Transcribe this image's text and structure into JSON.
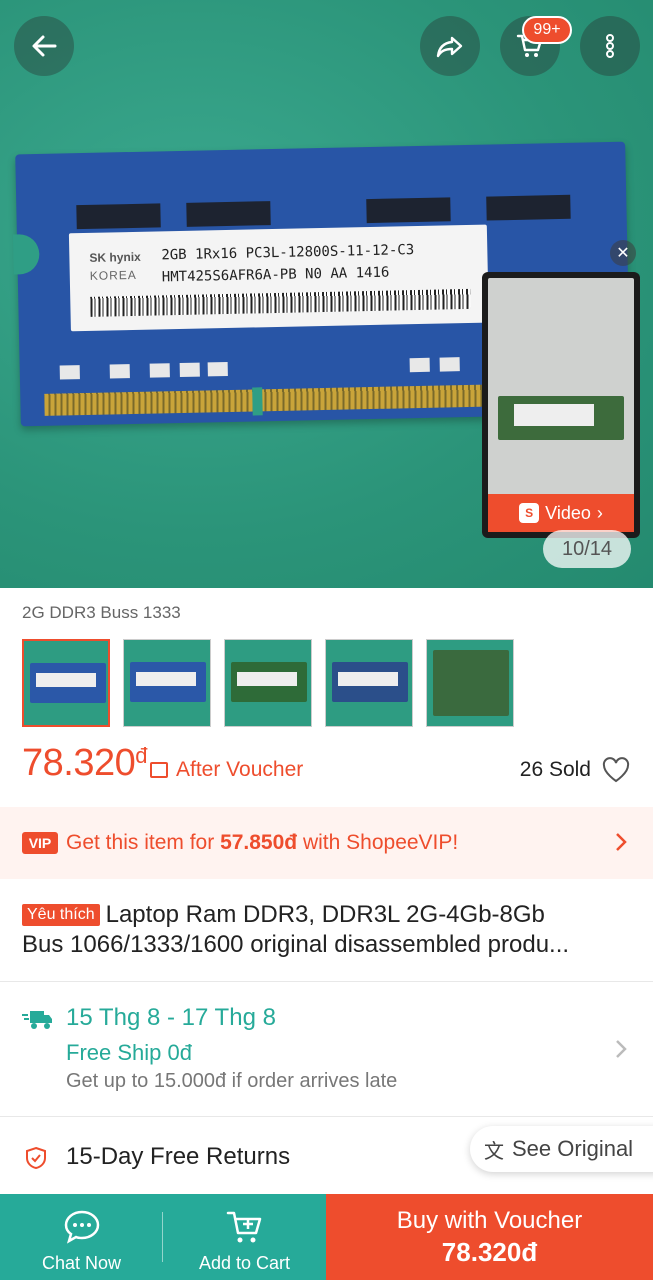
{
  "gallery": {
    "counter": "10/14",
    "video_label": "Video",
    "cart_badge": "99+",
    "ram_label": {
      "brand": "SK hynix",
      "brand_sub": "KOREA",
      "line1": "2GB 1Rx16 PC3L-12800S-11-12-C3",
      "line2": "HMT425S6AFR6A-PB N0 AA  1416"
    }
  },
  "variation": {
    "name": "2G DDR3 Buss 1333",
    "thumb_count": 5,
    "selected_index": 0
  },
  "price": {
    "value": "78.320",
    "currency": "đ",
    "after_voucher": "After Voucher",
    "sold": "26 Sold"
  },
  "vip": {
    "badge": "VIP",
    "prefix": "Get this item for ",
    "amount": "57.850đ",
    "suffix": " with ShopeeVIP!"
  },
  "product": {
    "tag": "Yêu thích",
    "title_line1": "Laptop Ram DDR3, DDR3L 2G-4Gb-8Gb",
    "title_line2": "Bus 1066/1333/1600 original disassembled produ..."
  },
  "shipping": {
    "date": "15 Thg 8 - 17 Thg 8",
    "free": "Free Ship 0đ",
    "late": "Get up to 15.000đ if order arrives late"
  },
  "returns": {
    "text": "15-Day Free Returns"
  },
  "translate": {
    "label": "See Original"
  },
  "bottom_bar": {
    "chat": "Chat Now",
    "add_to_cart": "Add to Cart",
    "buy_line1": "Buy with Voucher",
    "buy_line2": "78.320đ"
  },
  "colors": {
    "brand": "#ee4d2d",
    "teal": "#26aa99"
  }
}
